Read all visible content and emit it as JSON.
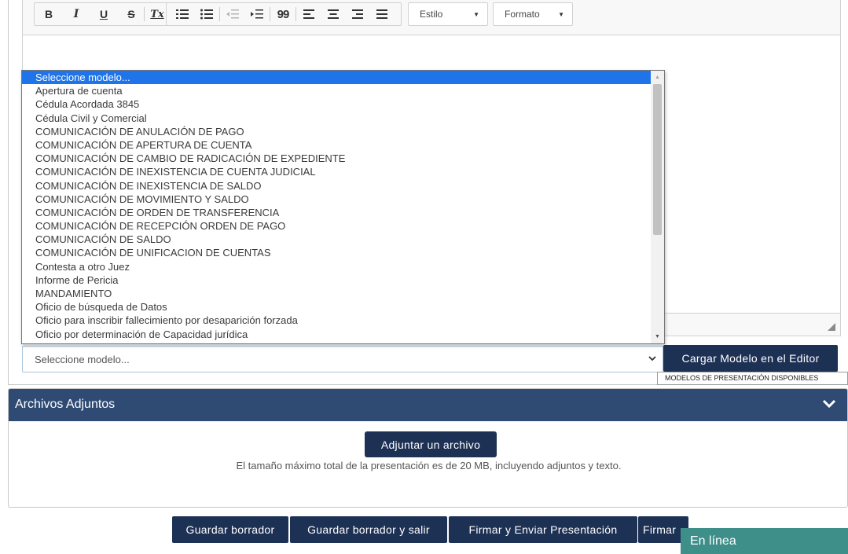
{
  "editor": {
    "toolbar": {
      "buttons": [
        {
          "label": "B",
          "icon": "bold-icon"
        },
        {
          "label": "I",
          "icon": "italic-icon"
        },
        {
          "label": "U",
          "icon": "underline-icon"
        },
        {
          "label": "S",
          "icon": "strikethrough-icon"
        },
        {
          "label": "Tx",
          "icon": "remove-format-icon"
        },
        {
          "icon": "numbered-list-icon"
        },
        {
          "icon": "bulleted-list-icon"
        },
        {
          "icon": "decrease-indent-icon"
        },
        {
          "icon": "increase-indent-icon"
        },
        {
          "label": "99",
          "icon": "blockquote-icon"
        },
        {
          "icon": "align-left-icon"
        },
        {
          "icon": "align-center-icon"
        },
        {
          "icon": "align-right-icon"
        },
        {
          "icon": "justify-icon"
        }
      ],
      "style_combo": "Estilo",
      "format_combo": "Formato"
    }
  },
  "model_dropdown": {
    "options": [
      "Seleccione modelo...",
      "Apertura de cuenta",
      "Cédula Acordada 3845",
      "Cédula Civil y Comercial",
      "COMUNICACIÓN DE ANULACIÓN DE PAGO",
      "COMUNICACIÓN DE APERTURA DE CUENTA",
      "COMUNICACIÓN DE CAMBIO DE RADICACIÓN DE EXPEDIENTE",
      "COMUNICACIÓN DE INEXISTENCIA DE CUENTA JUDICIAL",
      "COMUNICACIÓN DE INEXISTENCIA DE SALDO",
      "COMUNICACIÓN DE MOVIMIENTO Y SALDO",
      "COMUNICACIÓN DE ORDEN DE TRANSFERENCIA",
      "COMUNICACIÓN DE RECEPCIÓN ORDEN DE PAGO",
      "COMUNICACIÓN DE SALDO",
      "COMUNICACIÓN DE UNIFICACION DE CUENTAS",
      "Contesta a otro Juez",
      "Informe de Pericia",
      "MANDAMIENTO",
      "Oficio de búsqueda de Datos",
      "Oficio para inscribir fallecimiento por desaparición forzada",
      "Oficio por determinación de Capacidad jurídica"
    ],
    "selected_index": 0,
    "selected_value": "Seleccione modelo...",
    "load_button": "Cargar Modelo en el Editor",
    "tooltip": "MODELOS DE PRESENTACIÓN DISPONIBLES"
  },
  "attachments": {
    "title": "Archivos Adjuntos",
    "attach_button": "Adjuntar un archivo",
    "size_note": "El tamaño máximo total de la presentación es de 20 MB, incluyendo adjuntos y texto."
  },
  "actions": {
    "save_draft": "Guardar borrador",
    "save_draft_exit": "Guardar borrador y salir",
    "sign_send": "Firmar y Enviar Presentación",
    "sign": "Firmar"
  },
  "status": {
    "online": "En línea"
  }
}
